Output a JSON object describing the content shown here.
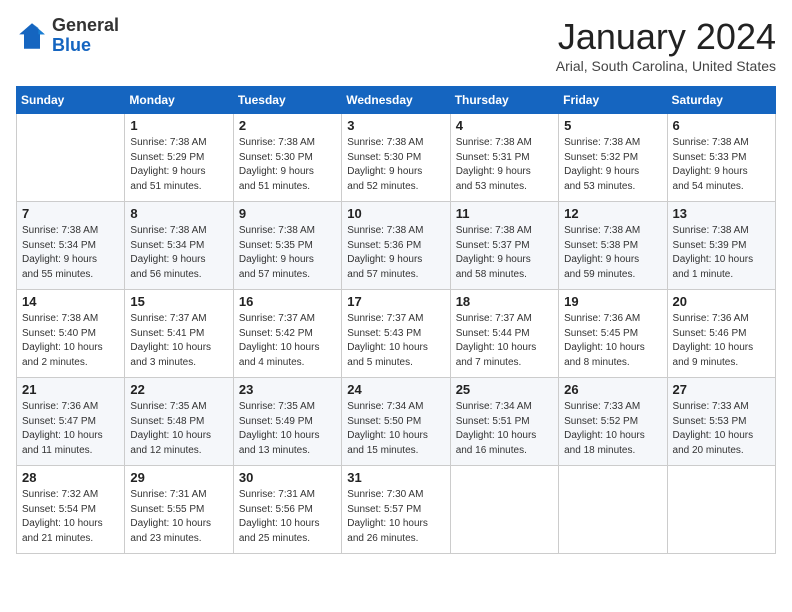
{
  "header": {
    "logo_general": "General",
    "logo_blue": "Blue",
    "month_title": "January 2024",
    "location": "Arial, South Carolina, United States"
  },
  "days_of_week": [
    "Sunday",
    "Monday",
    "Tuesday",
    "Wednesday",
    "Thursday",
    "Friday",
    "Saturday"
  ],
  "weeks": [
    [
      {
        "num": "",
        "info": ""
      },
      {
        "num": "1",
        "info": "Sunrise: 7:38 AM\nSunset: 5:29 PM\nDaylight: 9 hours\nand 51 minutes."
      },
      {
        "num": "2",
        "info": "Sunrise: 7:38 AM\nSunset: 5:30 PM\nDaylight: 9 hours\nand 51 minutes."
      },
      {
        "num": "3",
        "info": "Sunrise: 7:38 AM\nSunset: 5:30 PM\nDaylight: 9 hours\nand 52 minutes."
      },
      {
        "num": "4",
        "info": "Sunrise: 7:38 AM\nSunset: 5:31 PM\nDaylight: 9 hours\nand 53 minutes."
      },
      {
        "num": "5",
        "info": "Sunrise: 7:38 AM\nSunset: 5:32 PM\nDaylight: 9 hours\nand 53 minutes."
      },
      {
        "num": "6",
        "info": "Sunrise: 7:38 AM\nSunset: 5:33 PM\nDaylight: 9 hours\nand 54 minutes."
      }
    ],
    [
      {
        "num": "7",
        "info": "Sunrise: 7:38 AM\nSunset: 5:34 PM\nDaylight: 9 hours\nand 55 minutes."
      },
      {
        "num": "8",
        "info": "Sunrise: 7:38 AM\nSunset: 5:34 PM\nDaylight: 9 hours\nand 56 minutes."
      },
      {
        "num": "9",
        "info": "Sunrise: 7:38 AM\nSunset: 5:35 PM\nDaylight: 9 hours\nand 57 minutes."
      },
      {
        "num": "10",
        "info": "Sunrise: 7:38 AM\nSunset: 5:36 PM\nDaylight: 9 hours\nand 57 minutes."
      },
      {
        "num": "11",
        "info": "Sunrise: 7:38 AM\nSunset: 5:37 PM\nDaylight: 9 hours\nand 58 minutes."
      },
      {
        "num": "12",
        "info": "Sunrise: 7:38 AM\nSunset: 5:38 PM\nDaylight: 9 hours\nand 59 minutes."
      },
      {
        "num": "13",
        "info": "Sunrise: 7:38 AM\nSunset: 5:39 PM\nDaylight: 10 hours\nand 1 minute."
      }
    ],
    [
      {
        "num": "14",
        "info": "Sunrise: 7:38 AM\nSunset: 5:40 PM\nDaylight: 10 hours\nand 2 minutes."
      },
      {
        "num": "15",
        "info": "Sunrise: 7:37 AM\nSunset: 5:41 PM\nDaylight: 10 hours\nand 3 minutes."
      },
      {
        "num": "16",
        "info": "Sunrise: 7:37 AM\nSunset: 5:42 PM\nDaylight: 10 hours\nand 4 minutes."
      },
      {
        "num": "17",
        "info": "Sunrise: 7:37 AM\nSunset: 5:43 PM\nDaylight: 10 hours\nand 5 minutes."
      },
      {
        "num": "18",
        "info": "Sunrise: 7:37 AM\nSunset: 5:44 PM\nDaylight: 10 hours\nand 7 minutes."
      },
      {
        "num": "19",
        "info": "Sunrise: 7:36 AM\nSunset: 5:45 PM\nDaylight: 10 hours\nand 8 minutes."
      },
      {
        "num": "20",
        "info": "Sunrise: 7:36 AM\nSunset: 5:46 PM\nDaylight: 10 hours\nand 9 minutes."
      }
    ],
    [
      {
        "num": "21",
        "info": "Sunrise: 7:36 AM\nSunset: 5:47 PM\nDaylight: 10 hours\nand 11 minutes."
      },
      {
        "num": "22",
        "info": "Sunrise: 7:35 AM\nSunset: 5:48 PM\nDaylight: 10 hours\nand 12 minutes."
      },
      {
        "num": "23",
        "info": "Sunrise: 7:35 AM\nSunset: 5:49 PM\nDaylight: 10 hours\nand 13 minutes."
      },
      {
        "num": "24",
        "info": "Sunrise: 7:34 AM\nSunset: 5:50 PM\nDaylight: 10 hours\nand 15 minutes."
      },
      {
        "num": "25",
        "info": "Sunrise: 7:34 AM\nSunset: 5:51 PM\nDaylight: 10 hours\nand 16 minutes."
      },
      {
        "num": "26",
        "info": "Sunrise: 7:33 AM\nSunset: 5:52 PM\nDaylight: 10 hours\nand 18 minutes."
      },
      {
        "num": "27",
        "info": "Sunrise: 7:33 AM\nSunset: 5:53 PM\nDaylight: 10 hours\nand 20 minutes."
      }
    ],
    [
      {
        "num": "28",
        "info": "Sunrise: 7:32 AM\nSunset: 5:54 PM\nDaylight: 10 hours\nand 21 minutes."
      },
      {
        "num": "29",
        "info": "Sunrise: 7:31 AM\nSunset: 5:55 PM\nDaylight: 10 hours\nand 23 minutes."
      },
      {
        "num": "30",
        "info": "Sunrise: 7:31 AM\nSunset: 5:56 PM\nDaylight: 10 hours\nand 25 minutes."
      },
      {
        "num": "31",
        "info": "Sunrise: 7:30 AM\nSunset: 5:57 PM\nDaylight: 10 hours\nand 26 minutes."
      },
      {
        "num": "",
        "info": ""
      },
      {
        "num": "",
        "info": ""
      },
      {
        "num": "",
        "info": ""
      }
    ]
  ]
}
